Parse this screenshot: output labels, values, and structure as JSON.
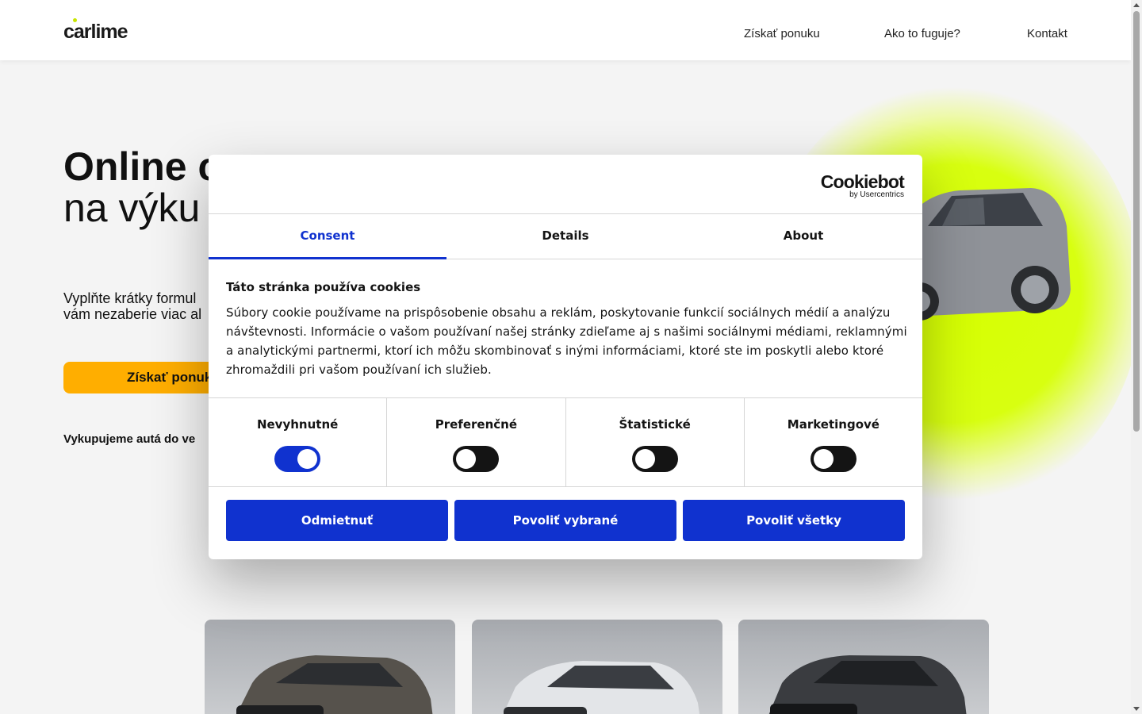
{
  "header": {
    "logo": "carlime",
    "nav": [
      "Získať ponuku",
      "Ako to fuguje?",
      "Kontakt"
    ]
  },
  "hero": {
    "title_line1": "Online c",
    "title_line2": "na výku",
    "subtitle_line1": "Vyplňte krátky formul",
    "subtitle_line2": "vám nezaberie viac al",
    "cta": "Získať ponuk",
    "note": "Vykupujeme autá do ve"
  },
  "cookie_dialog": {
    "brand": "Cookiebot",
    "brand_by": "by Usercentrics",
    "tabs": [
      "Consent",
      "Details",
      "About"
    ],
    "active_tab": "Consent",
    "heading": "Táto stránka používa cookies",
    "body": "Súbory cookie používame na prispôsobenie obsahu a reklám, poskytovanie funkcií sociálnych médií a analýzu návštevnosti. Informácie o vašom používaní našej stránky zdieľame aj s našimi sociálnymi médiami, reklamnými a analytickými partnermi, ktorí ich môžu skombinovať s inými informáciami, ktoré ste im poskytli alebo ktoré zhromaždili pri vašom používaní ich služieb.",
    "toggles": [
      {
        "label": "Nevyhnutné",
        "on": true
      },
      {
        "label": "Preferenčné",
        "on": false
      },
      {
        "label": "Štatistické",
        "on": false
      },
      {
        "label": "Marketingové",
        "on": false
      }
    ],
    "buttons": [
      "Odmietnuť",
      "Povoliť vybrané",
      "Povoliť všetky"
    ],
    "colors": {
      "accent": "#1032cf",
      "toggle_off": "#141414"
    }
  },
  "colors": {
    "cta": "#ffae00",
    "glow": "#d6ff00"
  }
}
